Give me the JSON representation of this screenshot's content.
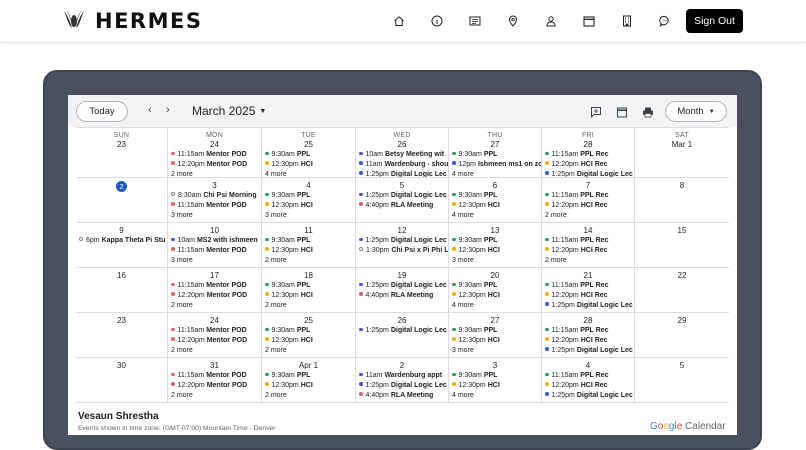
{
  "brand": {
    "name": "HERMES"
  },
  "nav": {
    "icons": [
      "home-icon",
      "info-icon",
      "list-icon",
      "location-icon",
      "user-icon",
      "calendar-icon",
      "building-icon",
      "chat-icon"
    ],
    "sign_out": "Sign Out"
  },
  "toolbar": {
    "today": "Today",
    "prev": "‹",
    "next": "›",
    "month_label": "March 2025",
    "view": "Month"
  },
  "colors": {
    "red": "#e06666",
    "green": "#2e9f5b",
    "yellow": "#f0b400",
    "blue": "#3c5bd6",
    "grey": "#888888"
  },
  "weeks": [
    [
      {
        "dow": "SUN",
        "num": "23",
        "events": [],
        "more": ""
      },
      {
        "dow": "MON",
        "num": "24",
        "events": [
          {
            "c": "red",
            "t": "11:15am",
            "n": "Mentor POD"
          },
          {
            "c": "red",
            "t": "12:20pm",
            "n": "Mentor POD"
          }
        ],
        "more": "2 more"
      },
      {
        "dow": "TUE",
        "num": "25",
        "events": [
          {
            "c": "green",
            "t": "9:30am",
            "n": "PPL"
          },
          {
            "c": "yellow",
            "t": "12:30pm",
            "n": "HCI"
          }
        ],
        "more": "4 more"
      },
      {
        "dow": "WED",
        "num": "26",
        "events": [
          {
            "c": "blue",
            "t": "10am",
            "n": "Betsy Meeting wit"
          },
          {
            "c": "blue",
            "t": "11am",
            "n": "Wardenburg - shou"
          },
          {
            "c": "blue",
            "t": "1:25pm",
            "n": "Digital Logic Lec"
          }
        ],
        "more": ""
      },
      {
        "dow": "THU",
        "num": "27",
        "events": [
          {
            "c": "green",
            "t": "9:30am",
            "n": "PPL"
          },
          {
            "c": "blue",
            "t": "12pm",
            "n": "Ishmeen ms1 on zc"
          }
        ],
        "more": "4 more"
      },
      {
        "dow": "FRI",
        "num": "28",
        "events": [
          {
            "c": "green",
            "t": "11:15am",
            "n": "PPL Rec"
          },
          {
            "c": "yellow",
            "t": "12:20pm",
            "n": "HCI Rec"
          },
          {
            "c": "blue",
            "t": "1:25pm",
            "n": "Digital Logic Lec"
          }
        ],
        "more": ""
      },
      {
        "dow": "SAT",
        "num": "Mar 1",
        "events": [],
        "more": ""
      }
    ],
    [
      {
        "num": "2",
        "today": true,
        "events": [],
        "more": ""
      },
      {
        "num": "3",
        "events": [
          {
            "c": "grey",
            "ring": true,
            "t": "8:30am",
            "n": "Chi Psi Morning"
          },
          {
            "c": "red",
            "t": "11:15am",
            "n": "Mentor POD"
          }
        ],
        "more": "3 more"
      },
      {
        "num": "4",
        "events": [
          {
            "c": "green",
            "t": "9:30am",
            "n": "PPL"
          },
          {
            "c": "yellow",
            "t": "12:30pm",
            "n": "HCI"
          }
        ],
        "more": "3 more"
      },
      {
        "num": "5",
        "events": [
          {
            "c": "blue",
            "t": "1:25pm",
            "n": "Digital Logic Lec"
          },
          {
            "c": "red",
            "t": "4:40pm",
            "n": "RLA Meeting"
          }
        ],
        "more": ""
      },
      {
        "num": "6",
        "events": [
          {
            "c": "green",
            "t": "9:30am",
            "n": "PPL"
          },
          {
            "c": "yellow",
            "t": "12:30pm",
            "n": "HCI"
          }
        ],
        "more": "4 more"
      },
      {
        "num": "7",
        "events": [
          {
            "c": "green",
            "t": "11:15am",
            "n": "PPL Rec"
          },
          {
            "c": "yellow",
            "t": "12:20pm",
            "n": "HCI Rec"
          }
        ],
        "more": "2 more"
      },
      {
        "num": "8",
        "events": [],
        "more": ""
      }
    ],
    [
      {
        "num": "9",
        "events": [
          {
            "c": "grey",
            "ring": true,
            "t": "6pm",
            "n": "Kappa Theta Pi Stu"
          }
        ],
        "more": ""
      },
      {
        "num": "10",
        "events": [
          {
            "c": "blue",
            "t": "10am",
            "n": "MS2 with ishmeen"
          },
          {
            "c": "red",
            "t": "11:15am",
            "n": "Mentor POD"
          }
        ],
        "more": "3 more"
      },
      {
        "num": "11",
        "events": [
          {
            "c": "green",
            "t": "9:30am",
            "n": "PPL"
          },
          {
            "c": "yellow",
            "t": "12:30pm",
            "n": "HCI"
          }
        ],
        "more": "2 more"
      },
      {
        "num": "12",
        "events": [
          {
            "c": "blue",
            "t": "1:25pm",
            "n": "Digital Logic Lec"
          },
          {
            "c": "grey",
            "ring": true,
            "t": "1:30pm",
            "n": "Chi Psi x Pi Phi L"
          }
        ],
        "more": ""
      },
      {
        "num": "13",
        "events": [
          {
            "c": "green",
            "t": "9:30am",
            "n": "PPL"
          },
          {
            "c": "yellow",
            "t": "12:30pm",
            "n": "HCI"
          }
        ],
        "more": "3 more"
      },
      {
        "num": "14",
        "events": [
          {
            "c": "green",
            "t": "11:15am",
            "n": "PPL Rec"
          },
          {
            "c": "yellow",
            "t": "12:20pm",
            "n": "HCI Rec"
          }
        ],
        "more": "2 more"
      },
      {
        "num": "15",
        "events": [],
        "more": ""
      }
    ],
    [
      {
        "num": "16",
        "events": [],
        "more": ""
      },
      {
        "num": "17",
        "events": [
          {
            "c": "red",
            "t": "11:15am",
            "n": "Mentor POD"
          },
          {
            "c": "red",
            "t": "12:20pm",
            "n": "Mentor POD"
          }
        ],
        "more": "2 more"
      },
      {
        "num": "18",
        "events": [
          {
            "c": "green",
            "t": "9:30am",
            "n": "PPL"
          },
          {
            "c": "yellow",
            "t": "12:30pm",
            "n": "HCI"
          }
        ],
        "more": "2 more"
      },
      {
        "num": "19",
        "events": [
          {
            "c": "blue",
            "t": "1:25pm",
            "n": "Digital Logic Lec"
          },
          {
            "c": "red",
            "t": "4:40pm",
            "n": "RLA Meeting"
          }
        ],
        "more": ""
      },
      {
        "num": "20",
        "events": [
          {
            "c": "green",
            "t": "9:30am",
            "n": "PPL"
          },
          {
            "c": "yellow",
            "t": "12:30pm",
            "n": "HCI"
          }
        ],
        "more": "4 more"
      },
      {
        "num": "21",
        "events": [
          {
            "c": "green",
            "t": "11:15am",
            "n": "PPL Rec"
          },
          {
            "c": "yellow",
            "t": "12:20pm",
            "n": "HCI Rec"
          },
          {
            "c": "blue",
            "t": "1:25pm",
            "n": "Digital Logic Lec"
          }
        ],
        "more": ""
      },
      {
        "num": "22",
        "events": [],
        "more": ""
      }
    ],
    [
      {
        "num": "23",
        "events": [],
        "more": ""
      },
      {
        "num": "24",
        "events": [
          {
            "c": "red",
            "t": "11:15am",
            "n": "Mentor POD"
          },
          {
            "c": "red",
            "t": "12:20pm",
            "n": "Mentor POD"
          }
        ],
        "more": "2 more"
      },
      {
        "num": "25",
        "events": [
          {
            "c": "green",
            "t": "9:30am",
            "n": "PPL"
          },
          {
            "c": "yellow",
            "t": "12:30pm",
            "n": "HCI"
          }
        ],
        "more": "2 more"
      },
      {
        "num": "26",
        "events": [
          {
            "c": "blue",
            "t": "1:25pm",
            "n": "Digital Logic Lec"
          }
        ],
        "more": ""
      },
      {
        "num": "27",
        "events": [
          {
            "c": "green",
            "t": "9:30am",
            "n": "PPL"
          },
          {
            "c": "yellow",
            "t": "12:30pm",
            "n": "HCI"
          }
        ],
        "more": "3 more"
      },
      {
        "num": "28",
        "events": [
          {
            "c": "green",
            "t": "11:15am",
            "n": "PPL Rec"
          },
          {
            "c": "yellow",
            "t": "12:20pm",
            "n": "HCI Rec"
          },
          {
            "c": "blue",
            "t": "1:25pm",
            "n": "Digital Logic Lec"
          }
        ],
        "more": ""
      },
      {
        "num": "29",
        "events": [],
        "more": ""
      }
    ],
    [
      {
        "num": "30",
        "events": [],
        "more": ""
      },
      {
        "num": "31",
        "events": [
          {
            "c": "red",
            "t": "11:15am",
            "n": "Mentor POD"
          },
          {
            "c": "red",
            "t": "12:20pm",
            "n": "Mentor POD"
          }
        ],
        "more": "2 more"
      },
      {
        "num": "Apr 1",
        "events": [
          {
            "c": "green",
            "t": "9:30am",
            "n": "PPL"
          },
          {
            "c": "yellow",
            "t": "12:30pm",
            "n": "HCI"
          }
        ],
        "more": "2 more"
      },
      {
        "num": "2",
        "events": [
          {
            "c": "blue",
            "t": "11am",
            "n": "Wardenburg appt"
          },
          {
            "c": "blue",
            "t": "1:25pm",
            "n": "Digital Logic Lec"
          },
          {
            "c": "red",
            "t": "4:40pm",
            "n": "RLA Meeting"
          }
        ],
        "more": ""
      },
      {
        "num": "3",
        "events": [
          {
            "c": "green",
            "t": "9:30am",
            "n": "PPL"
          },
          {
            "c": "yellow",
            "t": "12:30pm",
            "n": "HCI"
          }
        ],
        "more": "4 more"
      },
      {
        "num": "4",
        "events": [
          {
            "c": "green",
            "t": "11:15am",
            "n": "PPL Rec"
          },
          {
            "c": "yellow",
            "t": "12:20pm",
            "n": "HCI Rec"
          },
          {
            "c": "blue",
            "t": "1:25pm",
            "n": "Digital Logic Lec"
          }
        ],
        "more": ""
      },
      {
        "num": "5",
        "events": [],
        "more": ""
      }
    ]
  ],
  "footer": {
    "name": "Vesaun Shrestha",
    "timezone": "Events shown in time zone: (GMT-07:00) Mountain Time - Denver",
    "brand_google": [
      "G",
      "o",
      "o",
      "g",
      "l",
      "e"
    ],
    "brand_calendar": "Calendar"
  }
}
